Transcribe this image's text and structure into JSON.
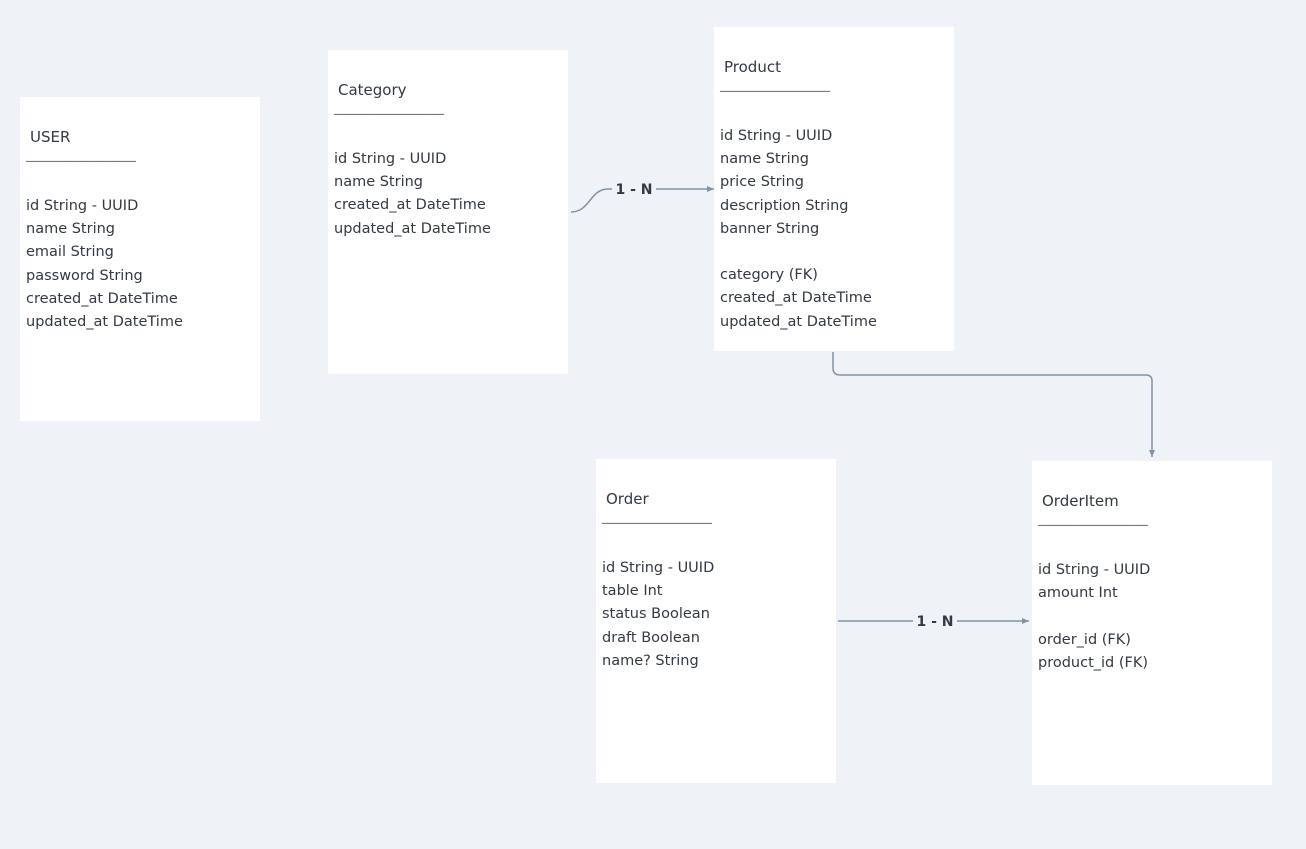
{
  "diagram": {
    "line_color": "#8193a6",
    "background_color": "#eff2f6",
    "card_color": "#ffffff",
    "entities": {
      "user": {
        "title": "USER",
        "rule": "____________________",
        "fields": [
          "id String - UUID",
          "name String",
          "email String",
          "password String",
          "created_at DateTime",
          "updated_at DateTime"
        ]
      },
      "category": {
        "title": "Category",
        "rule": "____________________",
        "fields": [
          "id String - UUID",
          "name String",
          "created_at DateTime",
          "updated_at DateTime"
        ]
      },
      "product": {
        "title": "Product",
        "rule": "____________________",
        "fields": [
          "id String - UUID",
          "name String",
          "price String",
          "description String",
          "banner String"
        ],
        "fields_extra": [
          "category (FK)",
          "created_at DateTime",
          "updated_at DateTime"
        ]
      },
      "order": {
        "title": "Order",
        "rule": "____________________",
        "fields": [
          "id String - UUID",
          "table Int",
          "status Boolean",
          "draft Boolean",
          "name? String"
        ]
      },
      "orderitem": {
        "title": "OrderItem",
        "rule": "____________________",
        "fields": [
          "id String - UUID",
          "amount Int"
        ],
        "fields_extra": [
          "order_id (FK)",
          "product_id (FK)"
        ]
      }
    },
    "relations": {
      "category_product": "1 - N",
      "order_orderitem": "1 - N"
    }
  }
}
